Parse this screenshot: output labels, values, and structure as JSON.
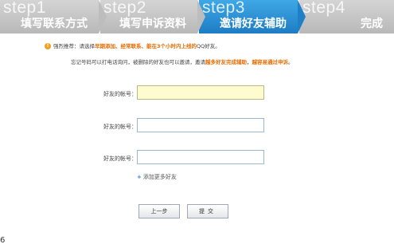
{
  "steps": [
    {
      "num": "step1",
      "name": "填写联系方式"
    },
    {
      "num": "step2",
      "name": "填写申诉资料"
    },
    {
      "num": "step3",
      "name": "邀请好友辅助"
    },
    {
      "num": "step4",
      "name": "完成"
    }
  ],
  "active_step": 3,
  "notice": {
    "prefix": "强烈推荐：请选择",
    "hl1": "早期添加、经常联系、能在3个小时内上线的",
    "suffix": "QQ好友。"
  },
  "note2": {
    "prefix": "忘记号码可以打电话询问，被删除的好友也可以邀请，邀请",
    "hl1": "越多好友完成辅助",
    "mid": "，",
    "hl2": "越容易通过申诉",
    "suffix": "。"
  },
  "fields": [
    {
      "label": "好友的帐号：",
      "value": ""
    },
    {
      "label": "好友的帐号：",
      "value": ""
    },
    {
      "label": "好友的帐号：",
      "value": ""
    }
  ],
  "add_more": "添加更多好友",
  "buttons": {
    "prev": "上一步",
    "submit": "提交"
  },
  "page_number": "6",
  "colors": {
    "active_step": "#1d7cc4",
    "inactive_step": "#c4c4c4",
    "highlight": "#e86c00",
    "field_focus": "#fefccf"
  }
}
